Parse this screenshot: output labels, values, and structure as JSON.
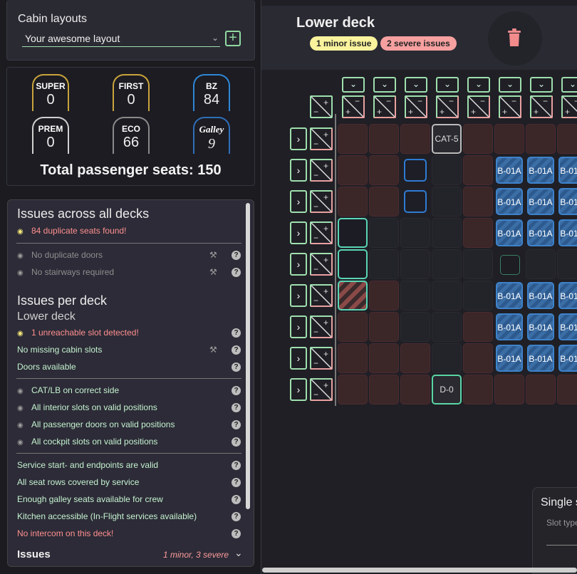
{
  "layout_panel": {
    "title": "Cabin layouts",
    "selected_layout": "Your awesome layout",
    "add_icon": "plus-icon"
  },
  "seat_classes": [
    {
      "name": "SUPER",
      "value": "0",
      "color": "#c9a33b",
      "italic": false
    },
    {
      "name": "FIRST",
      "value": "0",
      "color": "#c9a33b",
      "italic": false
    },
    {
      "name": "BZ",
      "value": "84",
      "color": "#2f86d6",
      "italic": false
    },
    {
      "name": "PREM",
      "value": "0",
      "color": "#d0d0d0",
      "italic": false
    },
    {
      "name": "ECO",
      "value": "66",
      "color": "#8a8a8a",
      "italic": false
    },
    {
      "name": "Galley",
      "value": "9",
      "color": "#2f6fb8",
      "italic": true
    }
  ],
  "total_seats": "Total passenger seats: 150",
  "issues": {
    "all_decks_title": "Issues across all decks",
    "all_decks": [
      {
        "text": "84 duplicate seats found!",
        "status": "red",
        "eye": true,
        "wrench": false,
        "help": false
      },
      {
        "text": "No duplicate doors",
        "status": "grey",
        "eye": true,
        "wrench": true,
        "help": true
      },
      {
        "text": "No stairways required",
        "status": "grey",
        "eye": true,
        "wrench": true,
        "help": true
      }
    ],
    "per_deck_title": "Issues per deck",
    "deck_name": "Lower deck",
    "per_deck": [
      {
        "text": "1 unreachable slot detected!",
        "status": "red",
        "eye": true,
        "wrench": false,
        "help": true
      },
      {
        "text": "No missing cabin slots",
        "status": "green",
        "eye": false,
        "wrench": true,
        "help": true
      },
      {
        "text": "Doors available",
        "status": "green",
        "eye": false,
        "wrench": false,
        "help": true
      },
      {
        "text": "CAT/LB on correct side",
        "status": "green",
        "eye": true,
        "wrench": false,
        "help": true
      },
      {
        "text": "All interior slots on valid positions",
        "status": "green",
        "eye": true,
        "wrench": false,
        "help": true
      },
      {
        "text": "All passenger doors on valid positions",
        "status": "green",
        "eye": true,
        "wrench": false,
        "help": true
      },
      {
        "text": "All cockpit slots on valid positions",
        "status": "green",
        "eye": true,
        "wrench": false,
        "help": true
      },
      {
        "text": "Service start- and endpoints are valid",
        "status": "green",
        "eye": false,
        "wrench": false,
        "help": true
      },
      {
        "text": "All seat rows covered by service",
        "status": "green",
        "eye": false,
        "wrench": false,
        "help": true
      },
      {
        "text": "Enough galley seats available for crew",
        "status": "green",
        "eye": false,
        "wrench": false,
        "help": true
      },
      {
        "text": "Kitchen accessible (In-Flight services available)",
        "status": "green",
        "eye": false,
        "wrench": false,
        "help": true
      },
      {
        "text": "No intercom on this deck!",
        "status": "red",
        "eye": false,
        "wrench": false,
        "help": true
      }
    ],
    "footer_label": "Issues",
    "footer_count": "1 minor, 3 severe"
  },
  "deck": {
    "title": "Lower deck",
    "badge_minor": "1 minor issue",
    "badge_severe": "2 severe issues",
    "trash_icon": "trash-icon",
    "collapse_icon": "double-chevron-left-icon",
    "cat_label": "CAT-5",
    "door_label": "D-0",
    "seat_label": "B-01A",
    "rows": [
      [
        "red",
        "red",
        "red",
        "cat",
        "red",
        "red",
        "red",
        "red"
      ],
      [
        "red",
        "red",
        "blue",
        "dark",
        "red",
        "seat",
        "seat",
        "seat"
      ],
      [
        "red",
        "red",
        "blue",
        "dark",
        "red",
        "seat",
        "seat",
        "seat"
      ],
      [
        "teal",
        "dark",
        "dark",
        "dark",
        "red",
        "seat",
        "seat",
        "seat"
      ],
      [
        "teal",
        "dark",
        "dark",
        "dark",
        "dark",
        "tealtiny",
        "dark",
        "dark"
      ],
      [
        "hatch",
        "red",
        "dark",
        "dark",
        "dark",
        "seat",
        "seat",
        "seat"
      ],
      [
        "red",
        "red",
        "dark",
        "dark",
        "red",
        "seat",
        "seat",
        "seat"
      ],
      [
        "red",
        "red",
        "red",
        "dark",
        "red",
        "seat",
        "seat",
        "seat"
      ],
      [
        "red",
        "red",
        "red",
        "door",
        "red",
        "red",
        "red",
        "red"
      ]
    ]
  },
  "single_panel": {
    "title": "Single s",
    "subtitle": "Slot type"
  }
}
